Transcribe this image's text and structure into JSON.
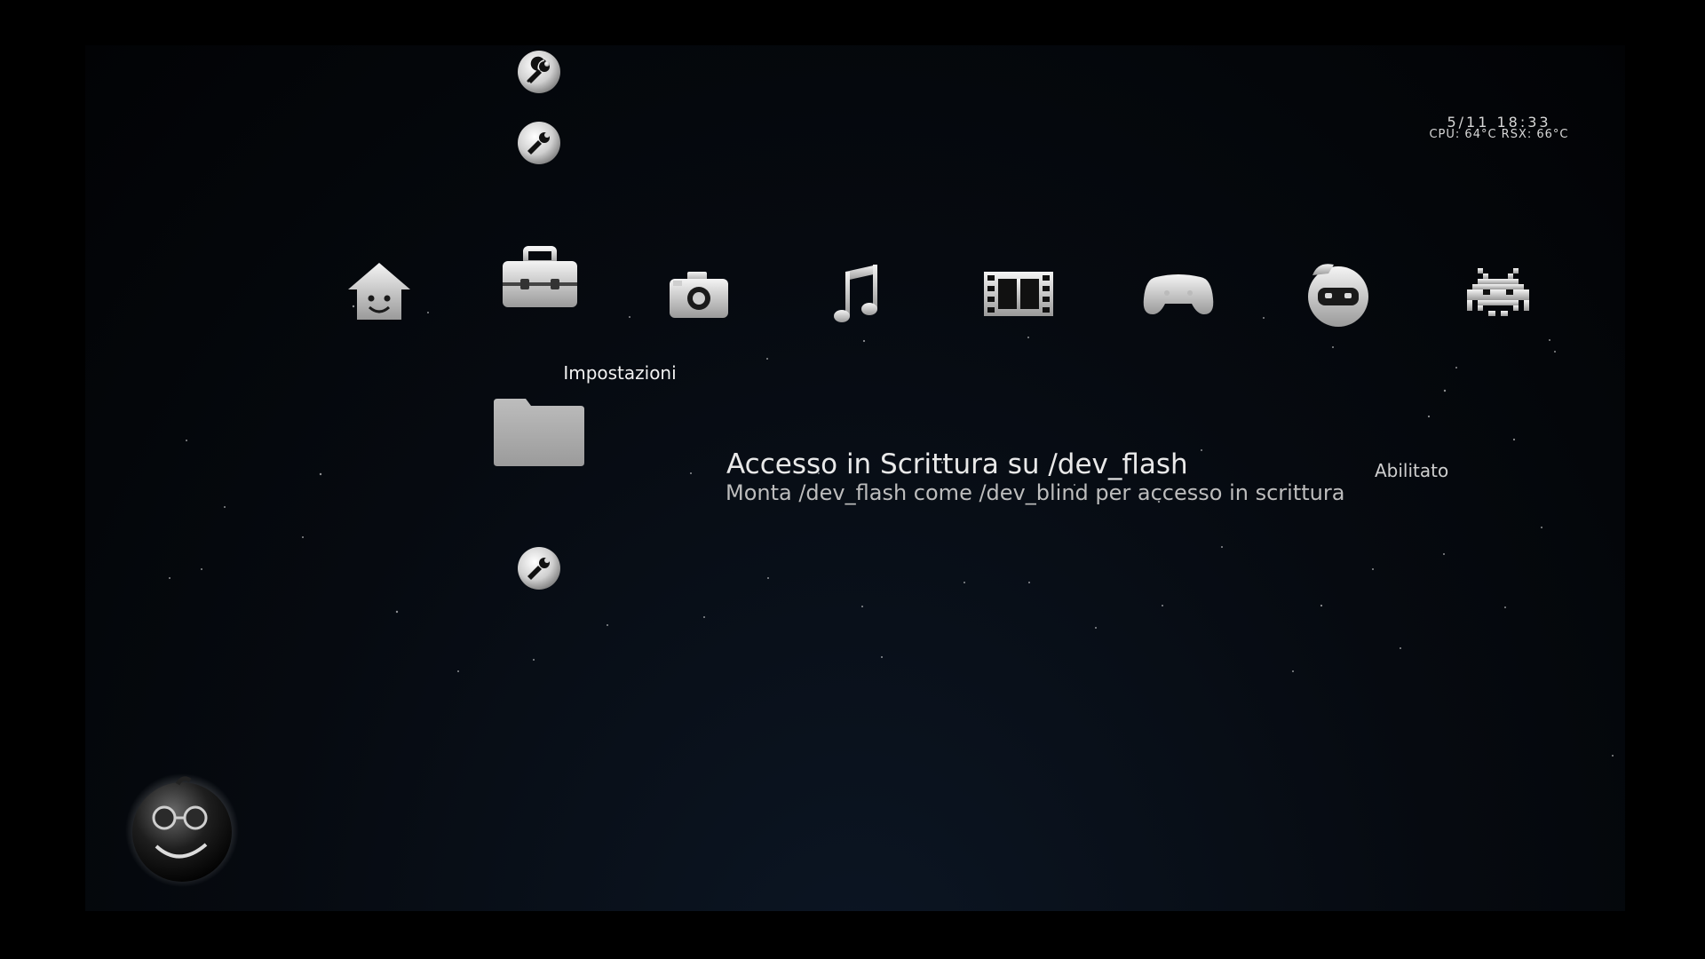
{
  "status": {
    "date_time": "5/11 18:33",
    "temps": "CPU: 64°C RSX: 66°C"
  },
  "categories": [
    {
      "icon": "home-icon",
      "label": ""
    },
    {
      "icon": "toolbox-icon",
      "label": "Impostazioni",
      "selected": true
    },
    {
      "icon": "camera-icon",
      "label": ""
    },
    {
      "icon": "music-icon",
      "label": ""
    },
    {
      "icon": "film-icon",
      "label": ""
    },
    {
      "icon": "gamepad-icon",
      "label": ""
    },
    {
      "icon": "robot-icon",
      "label": ""
    },
    {
      "icon": "invader-icon",
      "label": ""
    },
    {
      "icon": "globe-icon",
      "label": ""
    }
  ],
  "settings_items": [
    {
      "icon": "wrench-icon"
    },
    {
      "icon": "wrench-icon"
    },
    {
      "icon": "folder-icon",
      "title": "Accesso in Scrittura su /dev_flash",
      "description": "Monta /dev_flash come /dev_blind per accesso in scrittura",
      "value": "Abilitato",
      "selected": true
    },
    {
      "icon": "wrench-icon"
    }
  ],
  "avatar": {
    "icon": "smiley-avatar-icon"
  },
  "colors": {
    "icon": "#cfcfcf",
    "icon_dark": "#8f8f8f",
    "background": "#060a10"
  }
}
